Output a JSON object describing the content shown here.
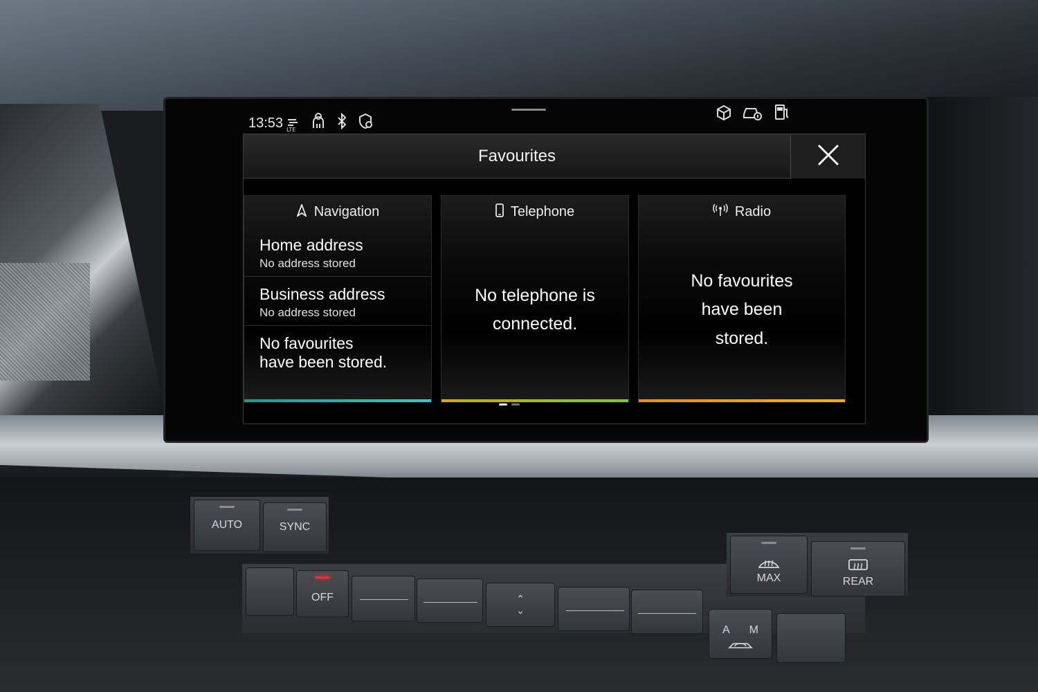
{
  "status_bar": {
    "time": "13:53",
    "icons_left": [
      "lte-signal-icon",
      "driver-profile-icon",
      "bluetooth-icon",
      "location-privacy-icon"
    ],
    "icons_right": [
      "package-icon",
      "car-info-icon",
      "fuel-icon"
    ]
  },
  "dialog": {
    "title": "Favourites",
    "close_icon": "close-icon"
  },
  "tiles": {
    "navigation": {
      "label": "Navigation",
      "icon": "navigation-arrow-icon",
      "accent": "#2fb6b0",
      "items": [
        {
          "primary": "Home address",
          "secondary": "No address stored"
        },
        {
          "primary": "Business address",
          "secondary": "No address stored"
        }
      ],
      "empty_line1": "No favourites",
      "empty_line2": "have been stored."
    },
    "telephone": {
      "label": "Telephone",
      "icon": "phone-icon",
      "accent": "#8fd13a",
      "message_line1": "No telephone is",
      "message_line2": "connected."
    },
    "radio": {
      "label": "Radio",
      "icon": "radio-antenna-icon",
      "accent": "#f39a1e",
      "message_line1": "No favourites",
      "message_line2": "have been",
      "message_line3": "stored."
    }
  },
  "pagination": {
    "pages": 2,
    "current": 1
  },
  "climate_controls": {
    "auto_label": "AUTO",
    "sync_label": "SYNC",
    "off_label": "OFF",
    "max_label": "MAX",
    "rear_label": "REAR",
    "am_left": "A",
    "am_right": "M"
  }
}
